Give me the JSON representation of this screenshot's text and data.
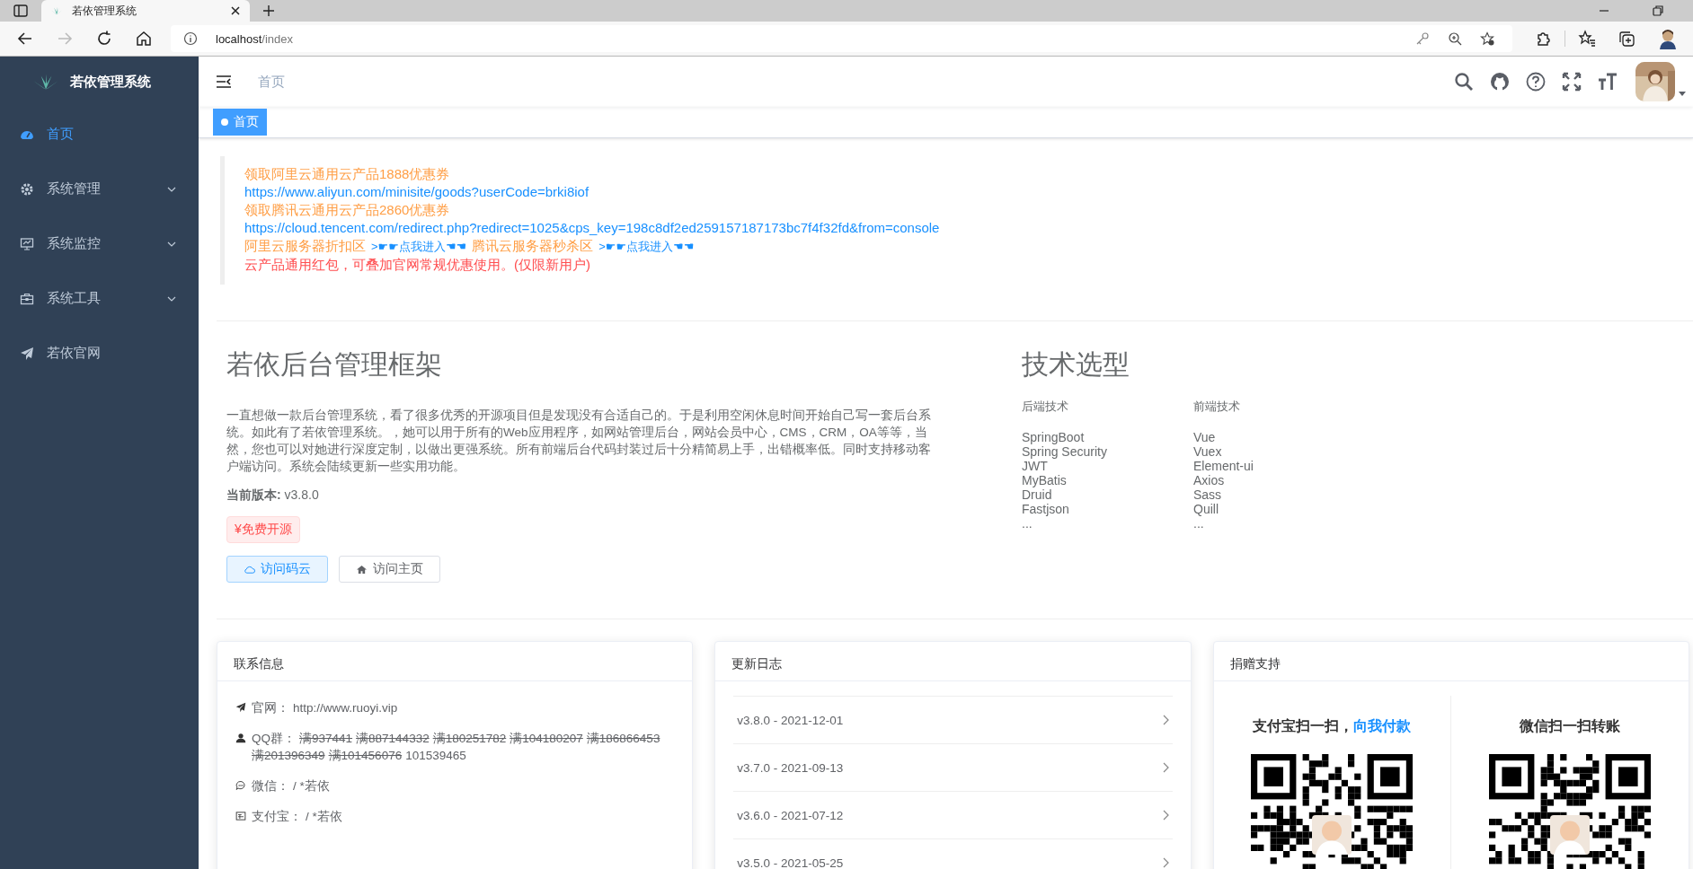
{
  "browser": {
    "tabs": [
      {
        "title": "若依管理系统",
        "selected": true
      }
    ],
    "url_host": "localhost",
    "url_path": "/index",
    "forward_disabled": true
  },
  "sidebar": {
    "title": "若依管理系统",
    "items": [
      {
        "label": "首页",
        "kind": "link",
        "selected": true
      },
      {
        "label": "系统管理",
        "kind": "submenu",
        "expanded": false,
        "selected": false
      },
      {
        "label": "系统监控",
        "kind": "submenu",
        "expanded": false,
        "selected": false
      },
      {
        "label": "系统工具",
        "kind": "submenu",
        "expanded": false,
        "selected": false
      },
      {
        "label": "若依官网",
        "kind": "link",
        "selected": false
      }
    ]
  },
  "header": {
    "breadcrumb": "首页"
  },
  "tags": [
    {
      "label": "首页",
      "selected": true
    }
  ],
  "notice": [
    {
      "kind": "promo",
      "text": "领取阿里云通用云产品1888优惠券"
    },
    {
      "kind": "link",
      "text": "https://www.aliyun.com/minisite/goods?userCode=brki8iof"
    },
    {
      "kind": "promo",
      "text": "领取腾讯云通用云产品2860优惠券"
    },
    {
      "kind": "link",
      "text": "https://cloud.tencent.com/redirect.php?redirect=1025&cps_key=198c8df2ed259157187173bc7f4f32fd&from=console"
    },
    {
      "kind": "row",
      "parts": [
        {
          "kind": "promo",
          "text": "阿里云服务器折扣区"
        },
        {
          "kind": "link",
          "text": ">☛☛点我进入☚☚"
        },
        {
          "kind": "promo",
          "text": "腾讯云服务器秒杀区"
        },
        {
          "kind": "link",
          "text": ">☛☛点我进入☚☚"
        }
      ]
    },
    {
      "kind": "note",
      "text": "云产品通用红包，可叠加官网常规优惠使用。(仅限新用户)"
    }
  ],
  "intro": {
    "title": "若依后台管理框架",
    "paragraph": "一直想做一款后台管理系统，看了很多优秀的开源项目但是发现没有合适自己的。于是利用空闲休息时间开始自己写一套后台系统。如此有了若依管理系统。，她可以用于所有的Web应用程序，如网站管理后台，网站会员中心，CMS，CRM，OA等等，当然，您也可以对她进行深度定制，以做出更强系统。所有前端后台代码封装过后十分精简易上手，出错概率低。同时支持移动客户端访问。系统会陆续更新一些实用功能。",
    "version_label": "当前版本:",
    "version": "v3.8.0",
    "tag": "¥免费开源",
    "buttons": [
      {
        "label": "访问码云",
        "kind": "primary"
      },
      {
        "label": "访问主页",
        "kind": "plain"
      }
    ]
  },
  "tech": {
    "title": "技术选型",
    "columns": [
      {
        "heading": "后端技术",
        "items": [
          "SpringBoot",
          "Spring Security",
          "JWT",
          "MyBatis",
          "Druid",
          "Fastjson",
          "..."
        ]
      },
      {
        "heading": "前端技术",
        "items": [
          "Vue",
          "Vuex",
          "Element-ui",
          "Axios",
          "Sass",
          "Quill",
          "..."
        ]
      }
    ]
  },
  "contact": {
    "title": "联系信息",
    "rows": [
      {
        "label": "官网：",
        "value": "http://www.ruoyi.vip"
      },
      {
        "label": "QQ群：",
        "groups": [
          {
            "text": "满937441",
            "full": true
          },
          {
            "text": "满887144332",
            "full": true
          },
          {
            "text": "满180251782",
            "full": true
          },
          {
            "text": "满104180207",
            "full": true
          },
          {
            "text": "满186866453",
            "full": true
          },
          {
            "text": "满201396349",
            "full": true
          },
          {
            "text": "满101456076",
            "full": true
          },
          {
            "text": "101539465",
            "full": false
          }
        ]
      },
      {
        "label": "微信：",
        "value": "/ *若依"
      },
      {
        "label": "支付宝：",
        "value": "/ *若依"
      }
    ]
  },
  "changelog": {
    "title": "更新日志",
    "items": [
      "v3.8.0 - 2021-12-01",
      "v3.7.0 - 2021-09-13",
      "v3.6.0 - 2021-07-12",
      "v3.5.0 - 2021-05-25"
    ]
  },
  "donate": {
    "title": "捐赠支持",
    "alipay_text": "支付宝扫一扫，",
    "alipay_link": "向我付款",
    "wechat_text": "微信扫一扫转账"
  }
}
